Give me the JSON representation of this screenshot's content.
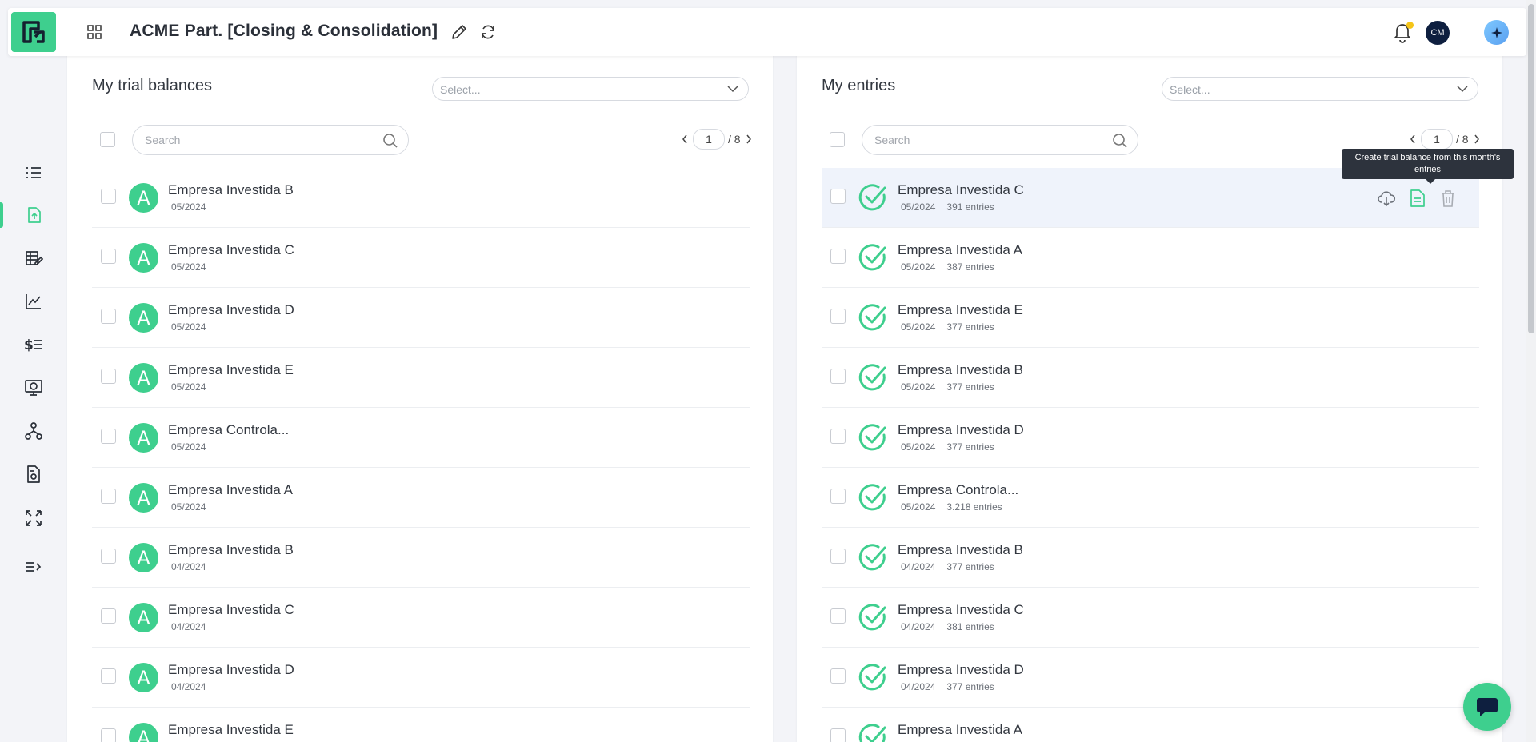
{
  "header": {
    "title": "ACME Part. [Closing & Consolidation]",
    "avatar_initials": "CM"
  },
  "colors": {
    "accent": "#3ecf8e",
    "avatar_bg": "#0e1f3f",
    "notification_dot": "#f5c518"
  },
  "sidebar": {
    "items": [
      {
        "icon": "list-icon"
      },
      {
        "icon": "upload-file-icon",
        "active": true
      },
      {
        "icon": "ledger-edit-icon"
      },
      {
        "icon": "line-chart-icon"
      },
      {
        "icon": "dollar-list-icon"
      },
      {
        "icon": "monitor-dollar-icon"
      },
      {
        "icon": "hierarchy-icon"
      },
      {
        "icon": "report-document-icon"
      },
      {
        "icon": "expand-arrows-icon"
      },
      {
        "icon": "collapse-sidebar-icon"
      }
    ]
  },
  "trial_balances": {
    "title": "My trial balances",
    "select_placeholder": "Select...",
    "search_placeholder": "Search",
    "page": "1",
    "total_pages": "/ 8",
    "rows": [
      {
        "badge": "A",
        "name": "Empresa Investida B",
        "period": "05/2024"
      },
      {
        "badge": "A",
        "name": "Empresa Investida C",
        "period": "05/2024"
      },
      {
        "badge": "A",
        "name": "Empresa Investida D",
        "period": "05/2024"
      },
      {
        "badge": "A",
        "name": "Empresa Investida E",
        "period": "05/2024"
      },
      {
        "badge": "A",
        "name": "Empresa Controla...",
        "period": "05/2024"
      },
      {
        "badge": "A",
        "name": "Empresa Investida A",
        "period": "05/2024"
      },
      {
        "badge": "A",
        "name": "Empresa Investida B",
        "period": "04/2024"
      },
      {
        "badge": "A",
        "name": "Empresa Investida C",
        "period": "04/2024"
      },
      {
        "badge": "A",
        "name": "Empresa Investida D",
        "period": "04/2024"
      },
      {
        "badge": "A",
        "name": "Empresa Investida E",
        "period": ""
      }
    ]
  },
  "entries": {
    "title": "My entries",
    "select_placeholder": "Select...",
    "search_placeholder": "Search",
    "page": "1",
    "total_pages": "/ 8",
    "tooltip": "Create trial balance from this month's entries",
    "rows": [
      {
        "name": "Empresa Investida C",
        "period": "05/2024",
        "count": "391 entries"
      },
      {
        "name": "Empresa Investida A",
        "period": "05/2024",
        "count": "387 entries"
      },
      {
        "name": "Empresa Investida E",
        "period": "05/2024",
        "count": "377 entries"
      },
      {
        "name": "Empresa Investida B",
        "period": "05/2024",
        "count": "377 entries"
      },
      {
        "name": "Empresa Investida D",
        "period": "05/2024",
        "count": "377 entries"
      },
      {
        "name": "Empresa Controla...",
        "period": "05/2024",
        "count": "3.218 entries"
      },
      {
        "name": "Empresa Investida B",
        "period": "04/2024",
        "count": "377 entries"
      },
      {
        "name": "Empresa Investida C",
        "period": "04/2024",
        "count": "381 entries"
      },
      {
        "name": "Empresa Investida D",
        "period": "04/2024",
        "count": "377 entries"
      },
      {
        "name": "Empresa Investida A",
        "period": "",
        "count": ""
      }
    ]
  }
}
